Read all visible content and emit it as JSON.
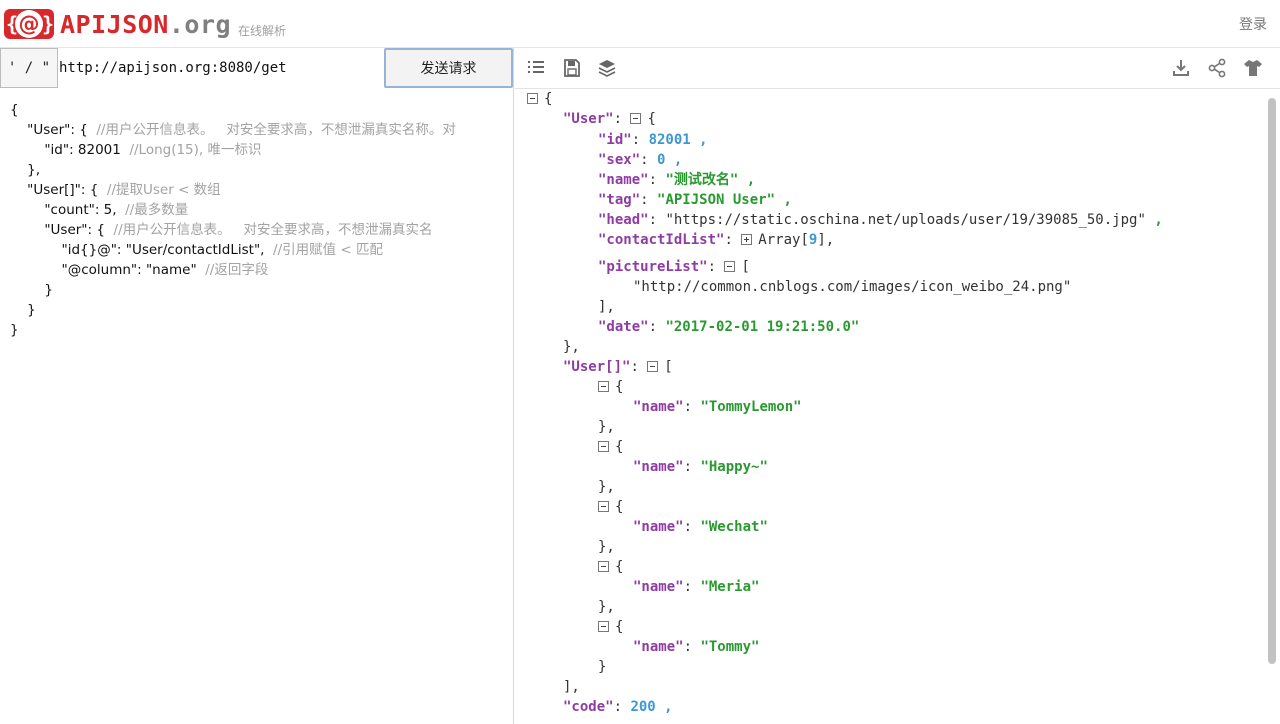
{
  "header": {
    "logo_api": "APIJSON",
    "logo_org": ".org",
    "tagline": "在线解析",
    "login": "登录"
  },
  "request": {
    "method": "' / \"",
    "url": "http://apijson.org:8080/get",
    "send_label": "发送请求",
    "lines": [
      {
        "code": "{",
        "comment": ""
      },
      {
        "code": "    \"User\": {  ",
        "comment": "//用户公开信息表。   对安全要求高，不想泄漏真实名称。对"
      },
      {
        "code": "        \"id\": 82001  ",
        "comment": "//Long(15), 唯一标识"
      },
      {
        "code": "    },",
        "comment": ""
      },
      {
        "code": "    \"User[]\": {  ",
        "comment": "//提取User < 数组"
      },
      {
        "code": "        \"count\": 5,  ",
        "comment": "//最多数量"
      },
      {
        "code": "        \"User\": {  ",
        "comment": "//用户公开信息表。   对安全要求高，不想泄漏真实名"
      },
      {
        "code": "            \"id{}@\": \"User/contactIdList\",  ",
        "comment": "//引用赋值 < 匹配"
      },
      {
        "code": "            \"@column\": \"name\"  ",
        "comment": "//返回字段"
      },
      {
        "code": "        }",
        "comment": ""
      },
      {
        "code": "    }",
        "comment": ""
      },
      {
        "code": "}",
        "comment": ""
      }
    ]
  },
  "toolbar": {
    "icons": [
      "format-list-icon",
      "save-icon",
      "layers-icon",
      "download-icon",
      "share-icon",
      "theme-icon"
    ]
  },
  "response": {
    "user_key": "\"User\"",
    "id_key": "\"id\"",
    "id_val": "82001",
    "sex_key": "\"sex\"",
    "sex_val": "0",
    "name_key": "\"name\"",
    "name_val": "\"测试改名\"",
    "tag_key": "\"tag\"",
    "tag_val": "\"APIJSON User\"",
    "head_key": "\"head\"",
    "head_val": "\"https://static.oschina.net/uploads/user/19/39085_50.jpg\"",
    "contact_key": "\"contactIdList\"",
    "contact_label": "Array",
    "contact_count": "9",
    "picture_key": "\"pictureList\"",
    "picture_val": "\"http://common.cnblogs.com/images/icon_weibo_24.png\"",
    "date_key": "\"date\"",
    "date_val": "\"2017-02-01 19:21:50.0\"",
    "users_key": "\"User[]\"",
    "user_names": [
      "\"TommyLemon\"",
      "\"Happy~\"",
      "\"Wechat\"",
      "\"Meria\"",
      "\"Tommy\""
    ],
    "code_key": "\"code\"",
    "code_val": "200"
  }
}
